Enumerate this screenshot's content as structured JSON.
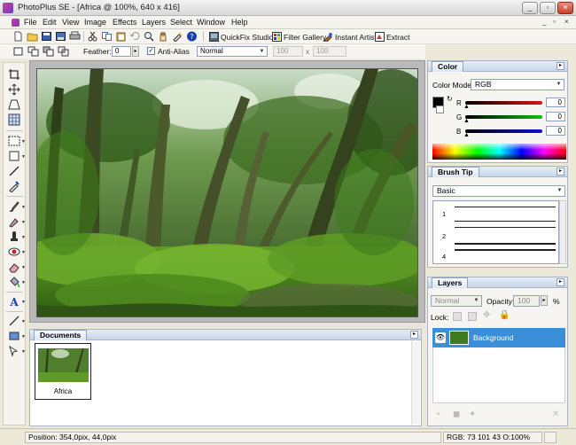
{
  "window": {
    "title": "PhotoPlus SE - [Africa @ 100%, 640 x 416]",
    "controls": [
      "_",
      "▫",
      "✕"
    ]
  },
  "menu": {
    "items": [
      "File",
      "Edit",
      "View",
      "Image",
      "Effects",
      "Layers",
      "Select",
      "Window",
      "Help"
    ],
    "doc_controls": [
      "_",
      "▫",
      "×"
    ]
  },
  "toolbar": {
    "quickfix_label": "QuickFix Studio",
    "filter_gallery_label": "Filter Gallery",
    "instant_artist_label": "Instant Artist",
    "extract_label": "Extract"
  },
  "options_bar": {
    "feather_label": "Feather:",
    "feather_value": "0",
    "antialias_label": "Anti-Alias",
    "antialias_checked": true,
    "mode_value": "Normal",
    "width_value": "100",
    "x_label": "x",
    "height_value": "100"
  },
  "documents_panel": {
    "title": "Documents",
    "thumbnail_label": "Africa"
  },
  "color_panel": {
    "title": "Color",
    "color_mode_label": "Color Mode:",
    "color_mode_value": "RGB",
    "channels": [
      {
        "label": "R",
        "value": "0",
        "color": "#d01a1a"
      },
      {
        "label": "G",
        "value": "0",
        "color": "#1ab21a"
      },
      {
        "label": "B",
        "value": "0",
        "color": "#1a1ad0"
      }
    ],
    "foreground": "#000000",
    "background": "#ffffff"
  },
  "brush_tip_panel": {
    "title": "Brush Tip",
    "category_value": "Basic",
    "brushes": [
      {
        "size": "1"
      },
      {
        "size": "2"
      },
      {
        "size": "4"
      }
    ]
  },
  "layers_panel": {
    "title": "Layers",
    "blend_value": "Normal",
    "opacity_label": "Opacity:",
    "opacity_value": "100",
    "opacity_unit": "%",
    "lock_label": "Lock:",
    "layers": [
      {
        "name": "Background",
        "visible": true,
        "selected": true
      }
    ]
  },
  "status": {
    "position": "Position: 354,0pix, 44,0pix",
    "rgb": "RGB: 73 101 43 O:100%"
  }
}
